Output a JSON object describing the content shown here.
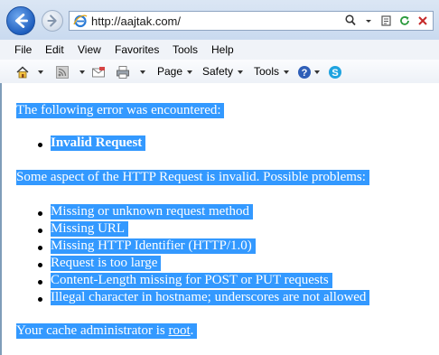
{
  "browser": {
    "url": "http://aajtak.com/"
  },
  "menu": {
    "file": "File",
    "edit": "Edit",
    "view": "View",
    "favorites": "Favorites",
    "tools": "Tools",
    "help": "Help"
  },
  "commandbar": {
    "page": "Page",
    "safety": "Safety",
    "tools": "Tools"
  },
  "error_page": {
    "heading": "The following error was encountered:",
    "error_title": "Invalid Request",
    "description": "Some aspect of the HTTP Request is invalid. Possible problems:",
    "problems": [
      "Missing or unknown request method",
      "Missing URL",
      "Missing HTTP Identifier (HTTP/1.0)",
      "Request is too large",
      "Content-Length missing for POST or PUT requests",
      "Illegal character in hostname; underscores are not allowed"
    ],
    "footer_prefix": "Your cache administrator is ",
    "footer_link": "root",
    "footer_suffix": "."
  },
  "colors": {
    "selection": "#3399ff"
  }
}
